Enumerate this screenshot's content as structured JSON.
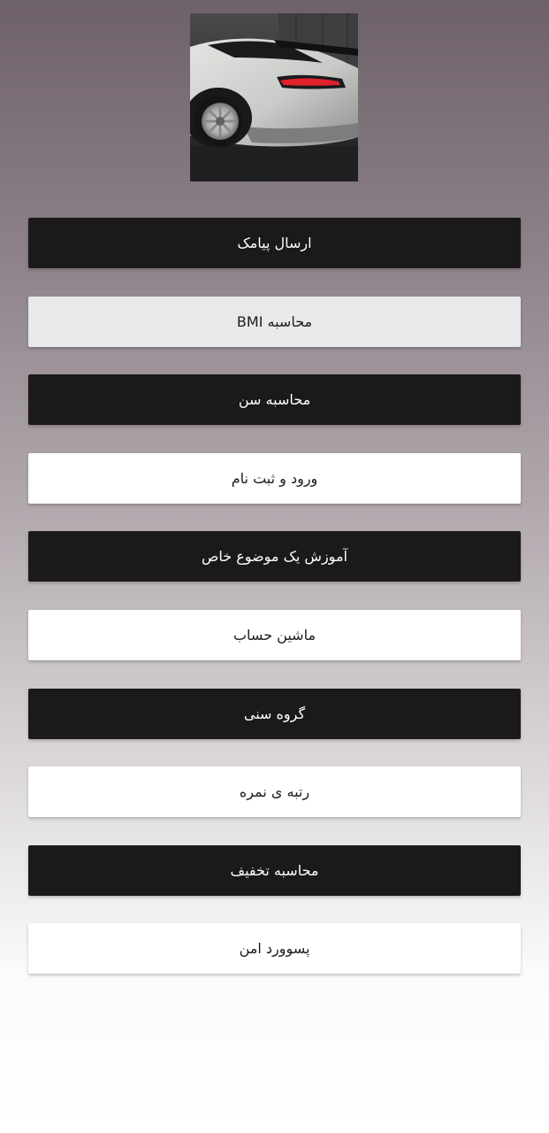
{
  "header": {
    "image_icon": "car-rear-photo"
  },
  "menu": {
    "items": [
      {
        "label": "ارسال پیامک",
        "style": "dark"
      },
      {
        "label": "محاسبه BMI",
        "style": "pressed"
      },
      {
        "label": "محاسبه سن",
        "style": "dark"
      },
      {
        "label": "ورود و ثبت نام",
        "style": "light"
      },
      {
        "label": "آموزش یک موضوع خاص",
        "style": "dark"
      },
      {
        "label": "ماشین حساب",
        "style": "light"
      },
      {
        "label": "گروه سنی",
        "style": "dark"
      },
      {
        "label": "رتبه ی نمره",
        "style": "light"
      },
      {
        "label": "محاسبه تخفیف",
        "style": "dark"
      },
      {
        "label": "پسوورد امن",
        "style": "light"
      }
    ]
  },
  "colors": {
    "dark_button": "#1b191a",
    "light_button": "#ffffff",
    "pressed_button": "#e7e9ea",
    "background_top": "#6e6169",
    "background_bottom": "#ffffff",
    "taillight": "#e0222c"
  }
}
